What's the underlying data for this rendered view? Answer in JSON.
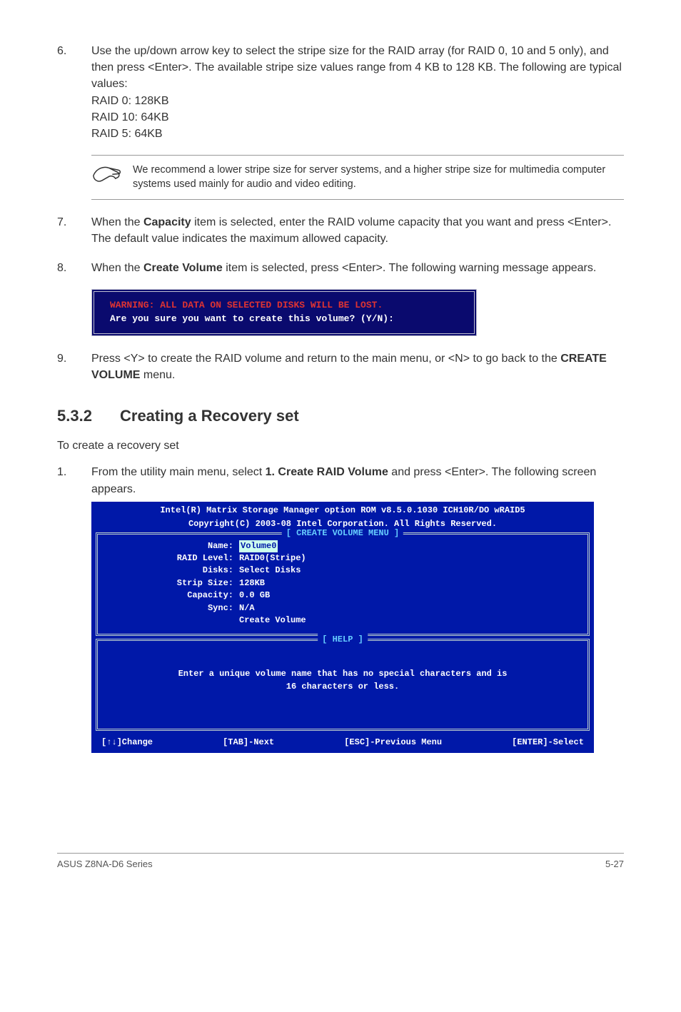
{
  "steps": {
    "s6": {
      "num": "6.",
      "body": "Use the up/down arrow key to select the stripe size for the RAID array (for RAID 0, 10 and 5 only), and then press <Enter>. The available stripe size values range from 4 KB to 128 KB. The following are typical values:",
      "lines": [
        "RAID 0: 128KB",
        "RAID 10: 64KB",
        "RAID 5: 64KB"
      ]
    },
    "note": "We recommend a lower stripe size for server systems, and a higher stripe size for multimedia computer systems used mainly for audio and video editing.",
    "s7": {
      "num": "7.",
      "pre": "When the ",
      "bold": "Capacity",
      "post": " item is selected, enter the RAID volume capacity that you want and press <Enter>. The default value indicates the maximum allowed capacity."
    },
    "s8": {
      "num": "8.",
      "pre": "When the ",
      "bold": "Create Volume",
      "post": " item is selected, press <Enter>. The following warning message appears."
    },
    "bios1": {
      "warn": "WARNING: ALL DATA ON SELECTED DISKS WILL BE LOST.",
      "line": "Are you sure you want to create this volume? (Y/N):"
    },
    "s9": {
      "num": "9.",
      "pre": "Press <Y> to create the RAID volume and return to the main menu, or <N> to go back to the ",
      "bold": "CREATE VOLUME",
      "post": " menu."
    }
  },
  "section": {
    "num": "5.3.2",
    "title": "Creating a Recovery set",
    "intro": "To create a recovery set",
    "s1": {
      "num": "1.",
      "pre": "From the utility main menu, select ",
      "bold": "1. Create RAID Volume",
      "post": " and press <Enter>. The following screen appears."
    }
  },
  "bios2": {
    "hdr1": "Intel(R) Matrix Storage Manager option ROM v8.5.0.1030 ICH10R/DO wRAID5",
    "hdr2": "Copyright(C) 2003-08 Intel Corporation.  All Rights Reserved.",
    "panel1_title": "[ CREATE VOLUME MENU ]",
    "rows": [
      {
        "lbl": "Name:",
        "val": "Volume0",
        "sel": true
      },
      {
        "lbl": "RAID Level:",
        "val": "RAID0(Stripe)"
      },
      {
        "lbl": "Disks:",
        "val": "Select Disks"
      },
      {
        "lbl": "Strip Size:",
        "val": " 128KB"
      },
      {
        "lbl": "Capacity:",
        "val": "0.0   GB"
      },
      {
        "lbl": "Sync:",
        "val": "N/A"
      },
      {
        "lbl": "",
        "val": "Create Volume"
      }
    ],
    "panel2_title": "[ HELP ]",
    "help1": "Enter a unique volume name that has no special characters and is",
    "help2": "16 characters or less.",
    "footer": [
      "[↑↓]Change",
      "[TAB]-Next",
      "[ESC]-Previous Menu",
      "[ENTER]-Select"
    ]
  },
  "footer": {
    "left": "ASUS Z8NA-D6 Series",
    "right": "5-27"
  }
}
